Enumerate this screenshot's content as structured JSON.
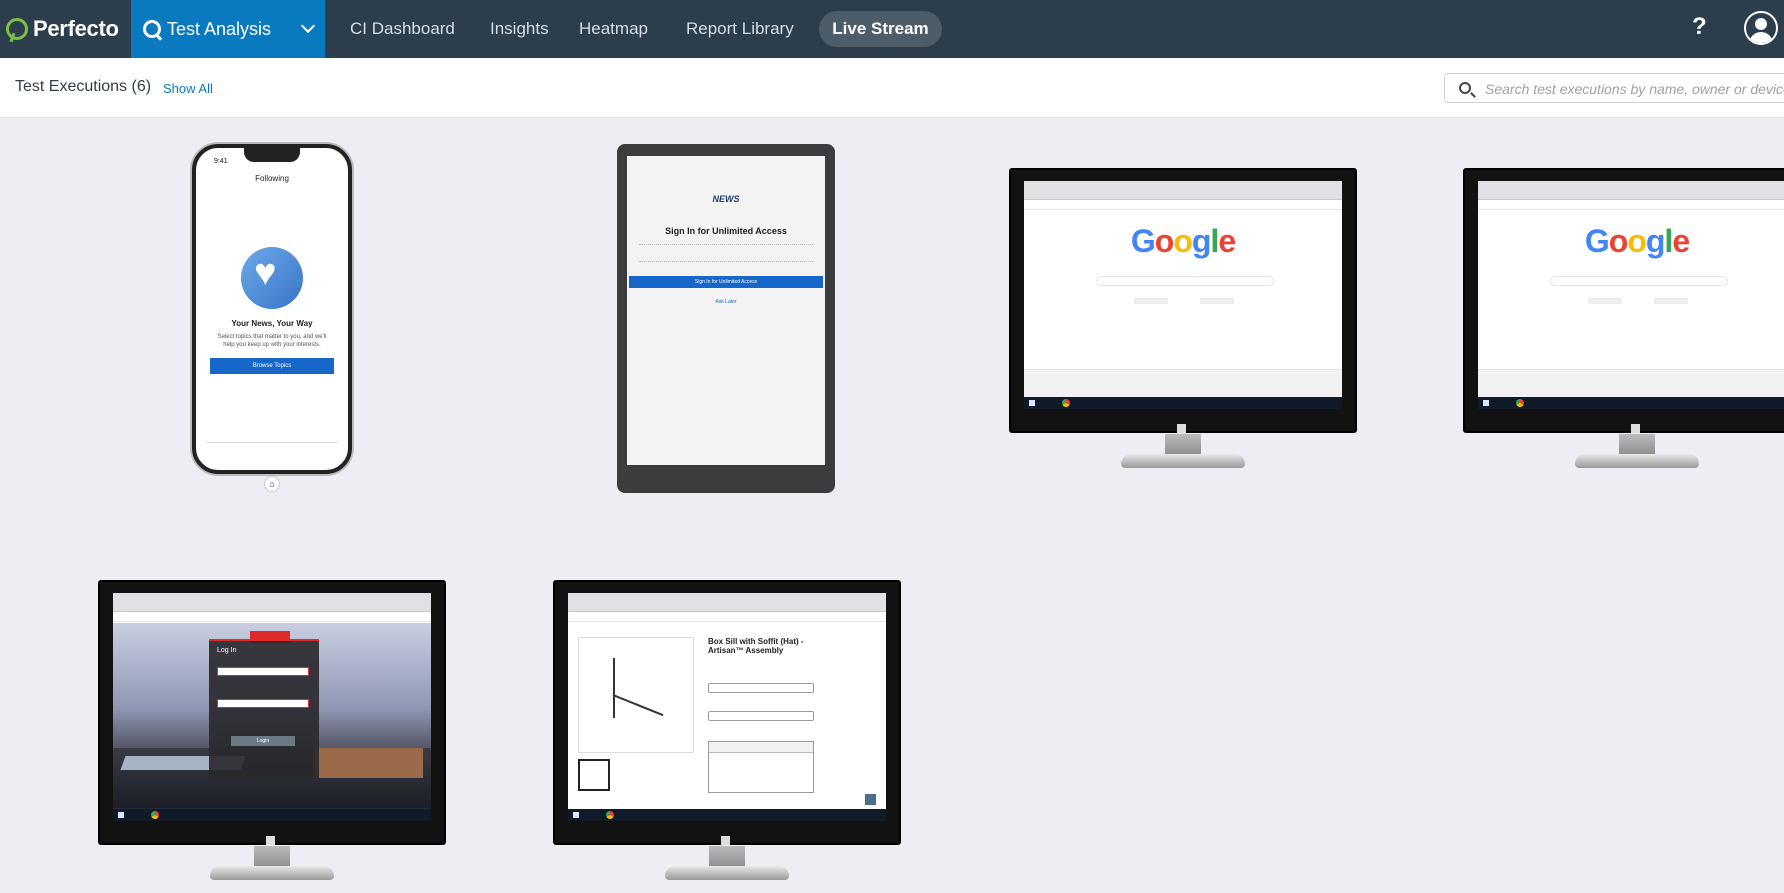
{
  "header": {
    "brand": "Perfecto",
    "product": "Test Analysis",
    "nav": [
      {
        "label": "CI Dashboard"
      },
      {
        "label": "Insights"
      },
      {
        "label": "Heatmap"
      },
      {
        "label": "Report Library"
      },
      {
        "label": "Live Stream",
        "active": true
      }
    ],
    "help": "?"
  },
  "subheader": {
    "title": "Test Executions (6)",
    "show_all": "Show All",
    "search_placeholder": "Search test executions by name, owner or device"
  },
  "devices": [
    {
      "type": "phone",
      "screen": {
        "time": "9:41",
        "header": "Following",
        "headline": "Your News, Your Way",
        "body": "Select topics that matter to you, and we'll help you keep up with your interests.",
        "button": "Browse Topics"
      }
    },
    {
      "type": "tablet",
      "screen": {
        "brand": "NEWS",
        "title": "Sign In for Unlimited Access",
        "button": "Sign In for Unlimited Access",
        "link": "Ask Later"
      }
    },
    {
      "type": "desktop",
      "screen": {
        "logo": "Google"
      }
    },
    {
      "type": "desktop",
      "screen": {
        "logo": "Google"
      }
    },
    {
      "type": "desktop",
      "screen": {
        "panel_title": "Log In",
        "login_button": "Login"
      }
    },
    {
      "type": "desktop",
      "screen": {
        "title": "Box Sill with Soffit (Hat) - Artisan™ Assembly"
      }
    }
  ],
  "colors": {
    "topbar": "#2c3e4c",
    "product": "#0a7ac0",
    "accent_green": "#7ac143",
    "background": "#edeef3"
  }
}
